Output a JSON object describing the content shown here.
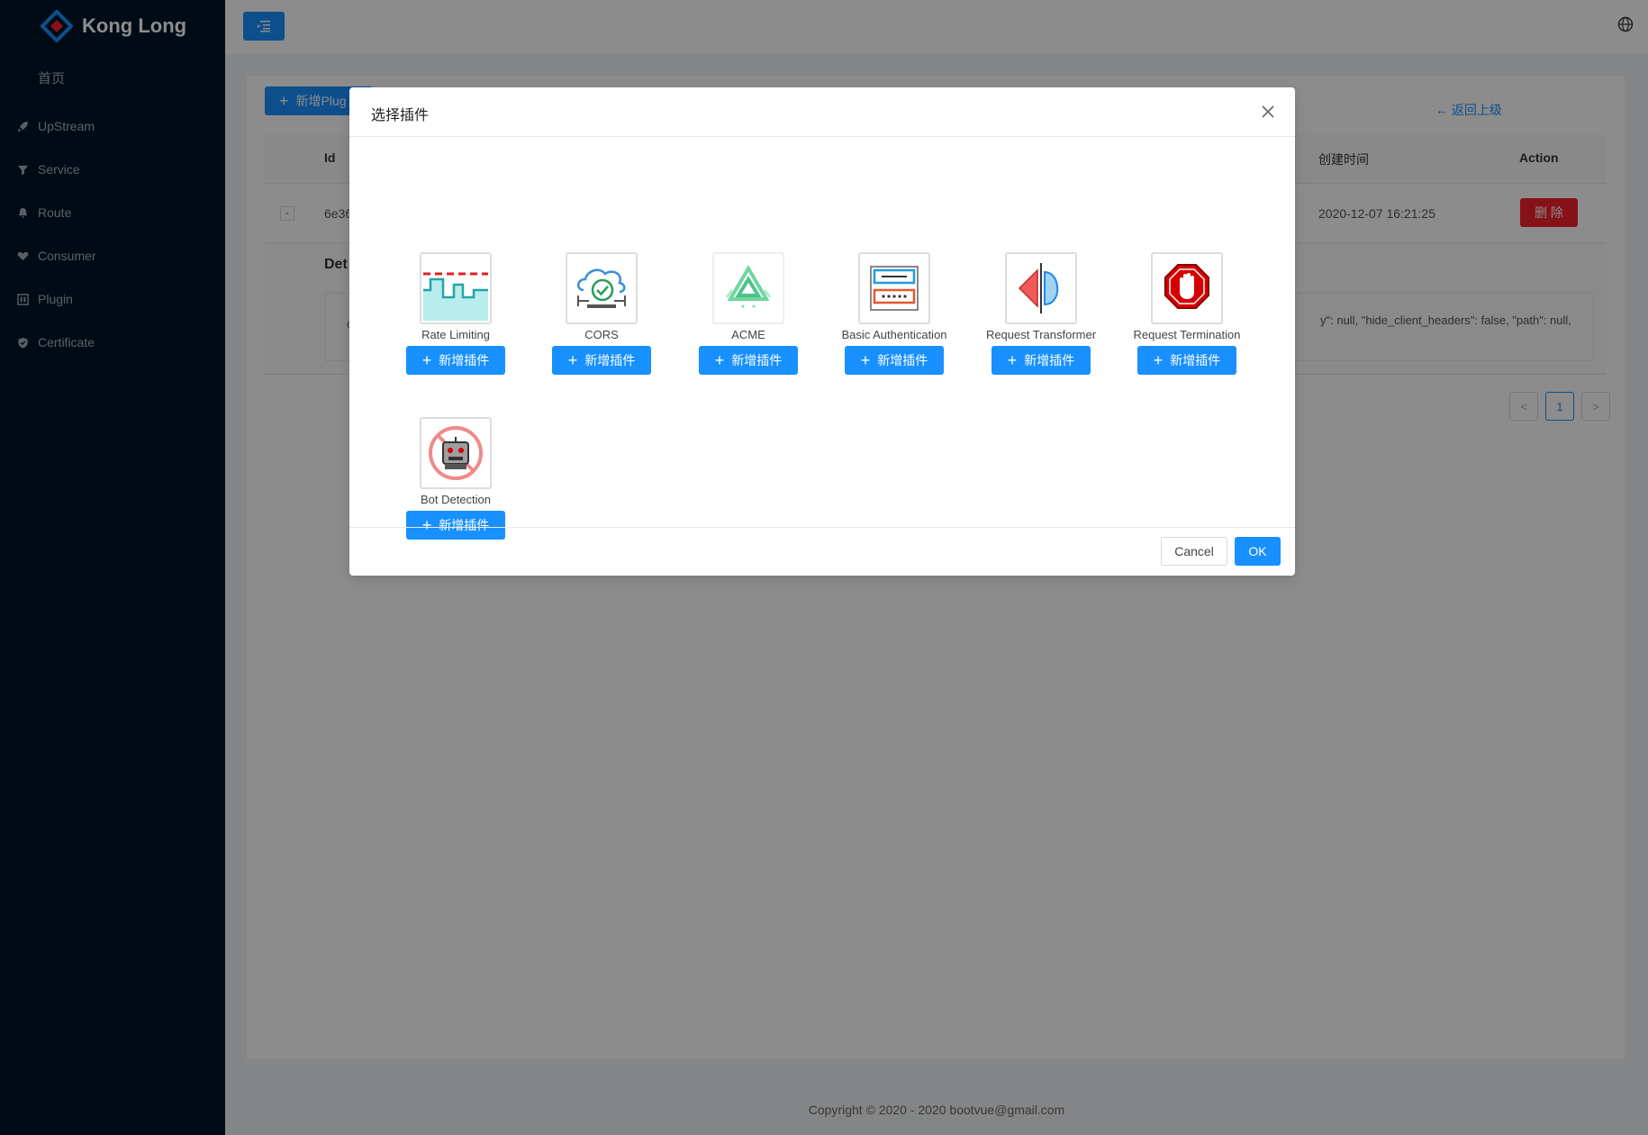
{
  "app": {
    "title": "Kong Long"
  },
  "sidebar": {
    "home": "首页",
    "items": [
      {
        "label": "UpStream",
        "icon": "rocket-icon"
      },
      {
        "label": "Service",
        "icon": "filter-icon"
      },
      {
        "label": "Route",
        "icon": "bell-icon"
      },
      {
        "label": "Consumer",
        "icon": "heart-icon"
      },
      {
        "label": "Plugin",
        "icon": "plugin-icon"
      },
      {
        "label": "Certificate",
        "icon": "shield-icon"
      }
    ]
  },
  "content": {
    "add_plugin_label": "新增Plug",
    "back_label": "返回上级",
    "table": {
      "columns": {
        "id": "Id",
        "created": "创建时间",
        "action": "Action"
      },
      "row": {
        "expand": "-",
        "id": "6e36",
        "created": "2020-12-07 16:21:25",
        "delete": "删 除"
      }
    },
    "detail_title": "Det",
    "detail_text": "y\": null, \"hide_client_headers\": false, \"path\": null,",
    "detail_text_left": "c",
    "pagination": {
      "prev": "<",
      "current": "1",
      "next": ">"
    }
  },
  "footer": {
    "copyright": "Copyright",
    "text": "2020 - 2020 bootvue@gmail.com"
  },
  "modal": {
    "title": "选择插件",
    "add_label": "新增插件",
    "plugins": [
      {
        "name": "Rate Limiting",
        "icon": "rate-limiting-icon"
      },
      {
        "name": "CORS",
        "icon": "cors-icon"
      },
      {
        "name": "ACME",
        "icon": "acme-icon"
      },
      {
        "name": "Basic Authentication",
        "icon": "basic-auth-icon"
      },
      {
        "name": "Request Transformer",
        "icon": "request-transformer-icon"
      },
      {
        "name": "Request Termination",
        "icon": "request-termination-icon"
      },
      {
        "name": "Bot Detection",
        "icon": "bot-detection-icon"
      }
    ],
    "cancel_label": "Cancel",
    "ok_label": "OK"
  },
  "colors": {
    "primary": "#1890ff",
    "sidebar_bg": "#001529",
    "danger": "#f5222d"
  }
}
